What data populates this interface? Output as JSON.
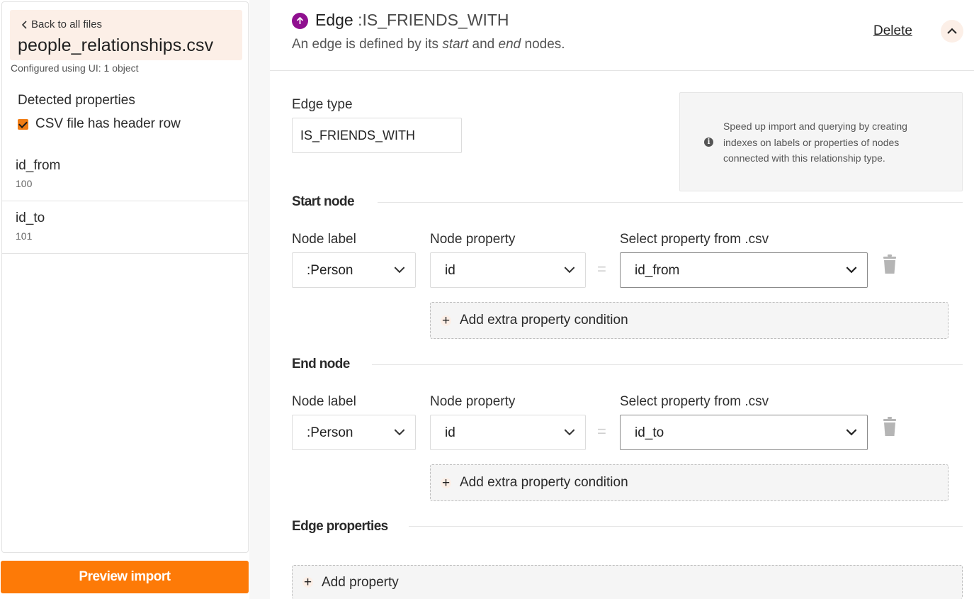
{
  "sidebar": {
    "back_label": "Back to all files",
    "file_name": "people_relationships.csv",
    "config_text": "Configured using UI: 1 object",
    "detected_title": "Detected properties",
    "header_row_label": "CSV file has header row",
    "header_row_checked": true,
    "properties": [
      {
        "name": "id_from",
        "sample": "100"
      },
      {
        "name": "id_to",
        "sample": "101"
      }
    ],
    "preview_button": "Preview import"
  },
  "edge": {
    "title_prefix": "Edge",
    "title_type": ":IS_FRIENDS_WITH",
    "subtitle_pre": "An edge is defined by its ",
    "subtitle_start": "start",
    "subtitle_mid": " and ",
    "subtitle_end": "end",
    "subtitle_post": " nodes.",
    "delete_label": "Delete",
    "edge_type_label": "Edge type",
    "edge_type_value": "IS_FRIENDS_WITH",
    "info_text": "Speed up import and querying by creating indexes on labels or properties of nodes connected with this relationship type.",
    "accent_color": "#8f0f8f"
  },
  "start_node": {
    "title": "Start node",
    "node_label_title": "Node label",
    "node_label_value": ":Person",
    "node_property_title": "Node property",
    "node_property_value": "id",
    "equals": "=",
    "csv_property_title": "Select property from .csv",
    "csv_property_value": "id_from",
    "add_condition_label": "Add extra property condition"
  },
  "end_node": {
    "title": "End node",
    "node_label_title": "Node label",
    "node_label_value": ":Person",
    "node_property_title": "Node property",
    "node_property_value": "id",
    "equals": "=",
    "csv_property_title": "Select property from .csv",
    "csv_property_value": "id_to",
    "add_condition_label": "Add extra property condition"
  },
  "edge_properties": {
    "title": "Edge properties",
    "add_property_label": "Add property"
  },
  "colors": {
    "brand_orange": "#fd7a07",
    "light_peach": "#fcefe7"
  }
}
